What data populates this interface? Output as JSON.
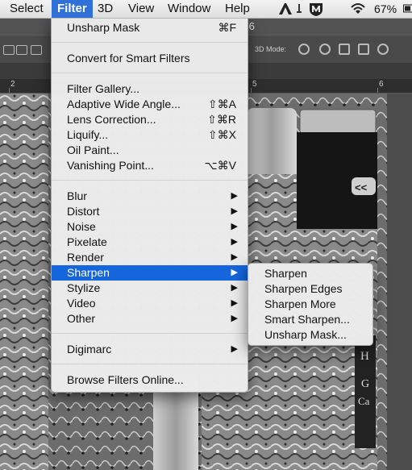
{
  "menubar": {
    "items": [
      "Select",
      "Filter",
      "3D",
      "View",
      "Window",
      "Help"
    ],
    "active_index": 1,
    "battery": "67%",
    "status_icons": [
      "adobe-icon",
      "sync-icon",
      "mcafee-icon",
      "wifi-icon",
      "battery-icon"
    ]
  },
  "app": {
    "title_fragment": "S6"
  },
  "options_bar": {
    "mode_label": "3D Mode:"
  },
  "ruler": {
    "ticks": [
      "2",
      "5",
      "6"
    ]
  },
  "filter_menu": {
    "items": [
      {
        "label": "Unsharp Mask",
        "shortcut": "⌘F"
      },
      {
        "label": "Convert for Smart Filters"
      },
      {
        "label": "Filter Gallery..."
      },
      {
        "label": "Adaptive Wide Angle...",
        "shortcut": "⇧⌘A"
      },
      {
        "label": "Lens Correction...",
        "shortcut": "⇧⌘R"
      },
      {
        "label": "Liquify...",
        "shortcut": "⇧⌘X"
      },
      {
        "label": "Oil Paint..."
      },
      {
        "label": "Vanishing Point...",
        "shortcut": "⌥⌘V"
      },
      {
        "label": "Blur",
        "submenu": true
      },
      {
        "label": "Distort",
        "submenu": true
      },
      {
        "label": "Noise",
        "submenu": true
      },
      {
        "label": "Pixelate",
        "submenu": true
      },
      {
        "label": "Render",
        "submenu": true
      },
      {
        "label": "Sharpen",
        "submenu": true,
        "highlighted": true
      },
      {
        "label": "Stylize",
        "submenu": true
      },
      {
        "label": "Video",
        "submenu": true
      },
      {
        "label": "Other",
        "submenu": true
      },
      {
        "label": "Digimarc",
        "submenu": true
      },
      {
        "label": "Browse Filters Online..."
      }
    ],
    "arrow_glyph": "▶"
  },
  "sharpen_submenu": {
    "items": [
      "Sharpen",
      "Sharpen Edges",
      "Sharpen More",
      "Smart Sharpen...",
      "Unsharp Mask..."
    ]
  },
  "canvas_text": {
    "label_h": "H",
    "label_g": "G",
    "label_ca": "Ca",
    "badge": "<<"
  },
  "colors": {
    "highlight": "#1565dd",
    "menu_bg": "#ececec",
    "menubar_active": "#2f70d9"
  }
}
